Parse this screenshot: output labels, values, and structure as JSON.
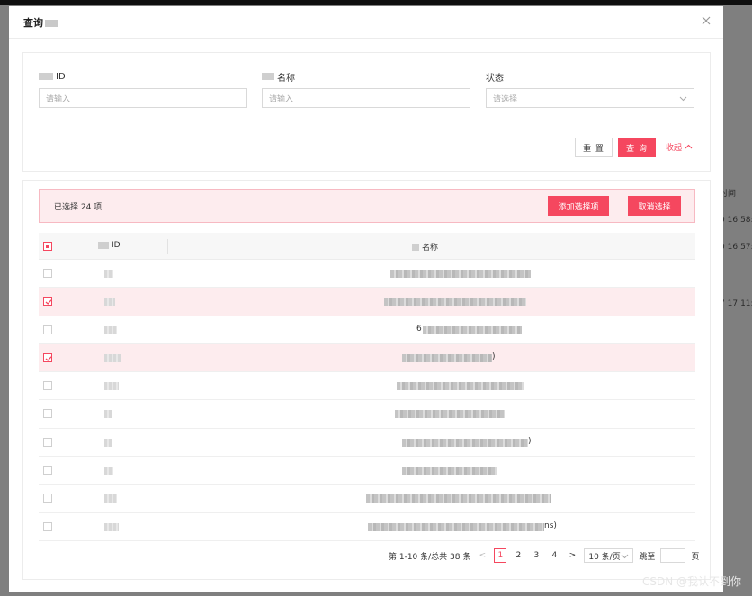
{
  "background": {
    "cells": [
      {
        "text": "时间"
      },
      {
        "text": "0 16:58:"
      },
      {
        "text": "0 16:57:"
      },
      {
        "text": "7 17:11:"
      }
    ]
  },
  "modal": {
    "title": "查询",
    "close_icon": "close-icon"
  },
  "search": {
    "fields": [
      {
        "label": "ID",
        "placeholder": "请输入"
      },
      {
        "label": "名称",
        "placeholder": "请输入"
      },
      {
        "label": "状态",
        "placeholder": "请选择"
      }
    ],
    "reset_label": "重 置",
    "query_label": "查 询",
    "collapse_label": "收起"
  },
  "selection": {
    "text": "已选择  24  项",
    "add_label": "添加选择项",
    "clear_label": "取消选择"
  },
  "table": {
    "headers": {
      "id": "ID",
      "name": "名称"
    },
    "rows": [
      {
        "checked": false,
        "name_suffix": ""
      },
      {
        "checked": true,
        "name_suffix": ""
      },
      {
        "checked": false,
        "name_prefix": "6",
        "name_suffix": ""
      },
      {
        "checked": true,
        "name_suffix": ")"
      },
      {
        "checked": false,
        "name_suffix": ""
      },
      {
        "checked": false,
        "name_suffix": ""
      },
      {
        "checked": false,
        "name_suffix": ")"
      },
      {
        "checked": false,
        "name_suffix": ""
      },
      {
        "checked": false,
        "name_suffix": ""
      },
      {
        "checked": false,
        "name_suffix": "ns)"
      }
    ]
  },
  "pagination": {
    "summary": "第 1-10 条/总共 38 条",
    "prev": "<",
    "pages": [
      "1",
      "2",
      "3",
      "4"
    ],
    "active_page": "1",
    "next": ">",
    "page_size": "10 条/页",
    "jump_label": "跳至",
    "jump_suffix": "页"
  },
  "watermark": "CSDN @我认不到你",
  "colors": {
    "accent": "#f5475f",
    "accent_light": "#fdecee"
  }
}
